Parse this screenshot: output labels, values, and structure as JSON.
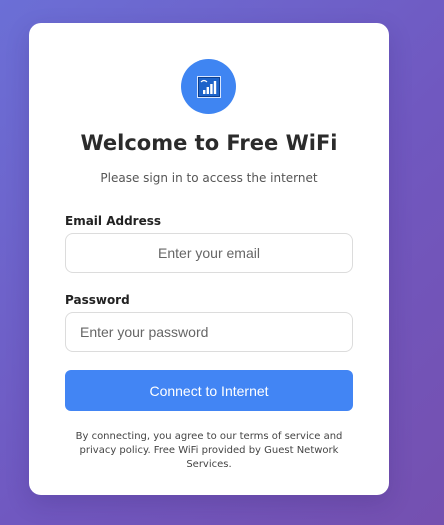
{
  "header": {
    "logo_icon": "wifi-signal-icon",
    "logo_color": "#3f85f2",
    "title": "Welcome to Free WiFi",
    "subtitle": "Please sign in to access the internet"
  },
  "form": {
    "email": {
      "label": "Email Address",
      "placeholder": "Enter your email",
      "value": ""
    },
    "password": {
      "label": "Password",
      "placeholder": "Enter your password",
      "value": ""
    },
    "submit_label": "Connect to Internet",
    "submit_color": "#4285f4"
  },
  "footer": {
    "terms_text": "By connecting, you agree to our terms of service and privacy policy. Free WiFi provided by Guest Network Services."
  }
}
